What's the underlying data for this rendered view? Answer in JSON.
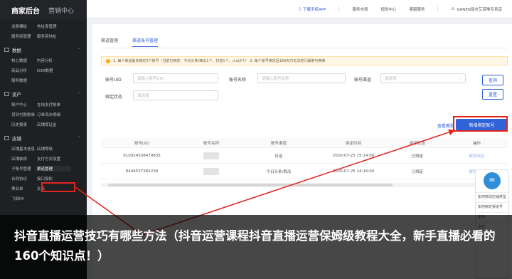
{
  "sidebar": {
    "brand": "商家后台",
    "brand_secondary": "营销中心",
    "top_rows": [
      [
        "运费模板",
        "地址库管理"
      ],
      [
        "服务商管理",
        "服务商地址"
      ]
    ],
    "groups": [
      {
        "title": "数据",
        "rows": [
          [
            "核心数据",
            "内容分析"
          ],
          [
            "商品分析",
            "DSR数据"
          ],
          [
            "服务数据",
            ""
          ]
        ]
      },
      {
        "title": "资产",
        "rows": [
          [
            "账户中心",
            "在线支付账单"
          ],
          [
            "货到付款账单",
            "订单流水明细"
          ],
          [
            "历史报表",
            "店铺保证金"
          ]
        ]
      },
      {
        "title": "店铺",
        "rows": [
          [
            "店铺基本信息",
            "店铺等级"
          ],
          [
            "店铺装修",
            "支付方式设置"
          ],
          [
            "子账号管理",
            "渠道管理"
          ],
          [
            "合同协议",
            "接口授权"
          ],
          [
            "黑名单",
            "关店"
          ],
          [
            "飞鸽IM",
            ""
          ]
        ]
      }
    ]
  },
  "topbar": {
    "download": "下载手机APP",
    "items": [
      "服务市场",
      "规则中心",
      "客服服务"
    ],
    "user": "DANEN丽市艾菲唯专卖店"
  },
  "tabs": [
    "渠道管理",
    "渠道账号管理"
  ],
  "notice": "1. 每个渠道最多绑定3个账号（当前已绑定：今日头条/西瓜1个，抖音1个，火山0个）  2. 每个账号绑定后180天内无法进行解绑与换绑",
  "filters": {
    "uid_label": "账号UID",
    "uid_placeholder": "请输入账号UID",
    "name_label": "账号名称",
    "name_placeholder": "请输入账号名称",
    "channel_label": "账号渠道",
    "channel_placeholder": "请选择",
    "status_label": "绑定状态",
    "status_placeholder": "请选择",
    "query_button": "查询",
    "reset_button": "重置"
  },
  "actions": {
    "help_link": "查看教程",
    "new_button": "新增绑定账号"
  },
  "table": {
    "headers": [
      "账号UID",
      "账号名称",
      "账号渠道",
      "绑定时间",
      "绑定状态",
      "操作"
    ],
    "rows": [
      [
        "61092450847983​5",
        "",
        "抖音",
        "2020-07-25 15:14:00",
        "已绑定",
        "解除绑定"
      ],
      [
        "84465373822​38",
        "",
        "今日头条/西瓜",
        "2020-07-25 14:16:00",
        "已绑定",
        "解除绑定"
      ]
    ]
  },
  "help_float": {
    "items": [
      "如何修改店铺类型",
      "如何绑定渠道号",
      "如何",
      "点击"
    ]
  },
  "caption": "抖音直播运营技巧有哪些方法（抖音运营课程抖音直播运营保姆级教程大全，新手直播必看的160个知识点！）",
  "colors": {
    "accent": "#2f63d8",
    "sidebar": "#1f2023",
    "highlight": "#e3231d"
  }
}
